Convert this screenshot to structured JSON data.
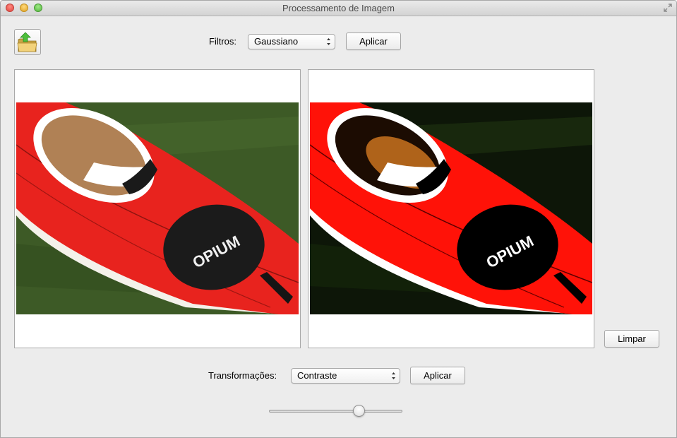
{
  "window": {
    "title": "Processamento de Imagem"
  },
  "toolbar": {
    "open_icon": "folder-open-icon"
  },
  "filters": {
    "label": "Filtros:",
    "selected": "Gaussiano",
    "apply_label": "Aplicar"
  },
  "images": {
    "original": {
      "subject": "red kayak on grass"
    },
    "processed": {
      "subject": "red kayak on grass (filtered)"
    }
  },
  "clear": {
    "label": "Limpar"
  },
  "transforms": {
    "label": "Transformações:",
    "selected": "Contraste",
    "apply_label": "Aplicar"
  },
  "slider": {
    "value_fraction": 0.67
  },
  "colors": {
    "window_bg": "#ececec",
    "kayak_red": "#e8231e",
    "grass_green": "#3d5a26"
  }
}
